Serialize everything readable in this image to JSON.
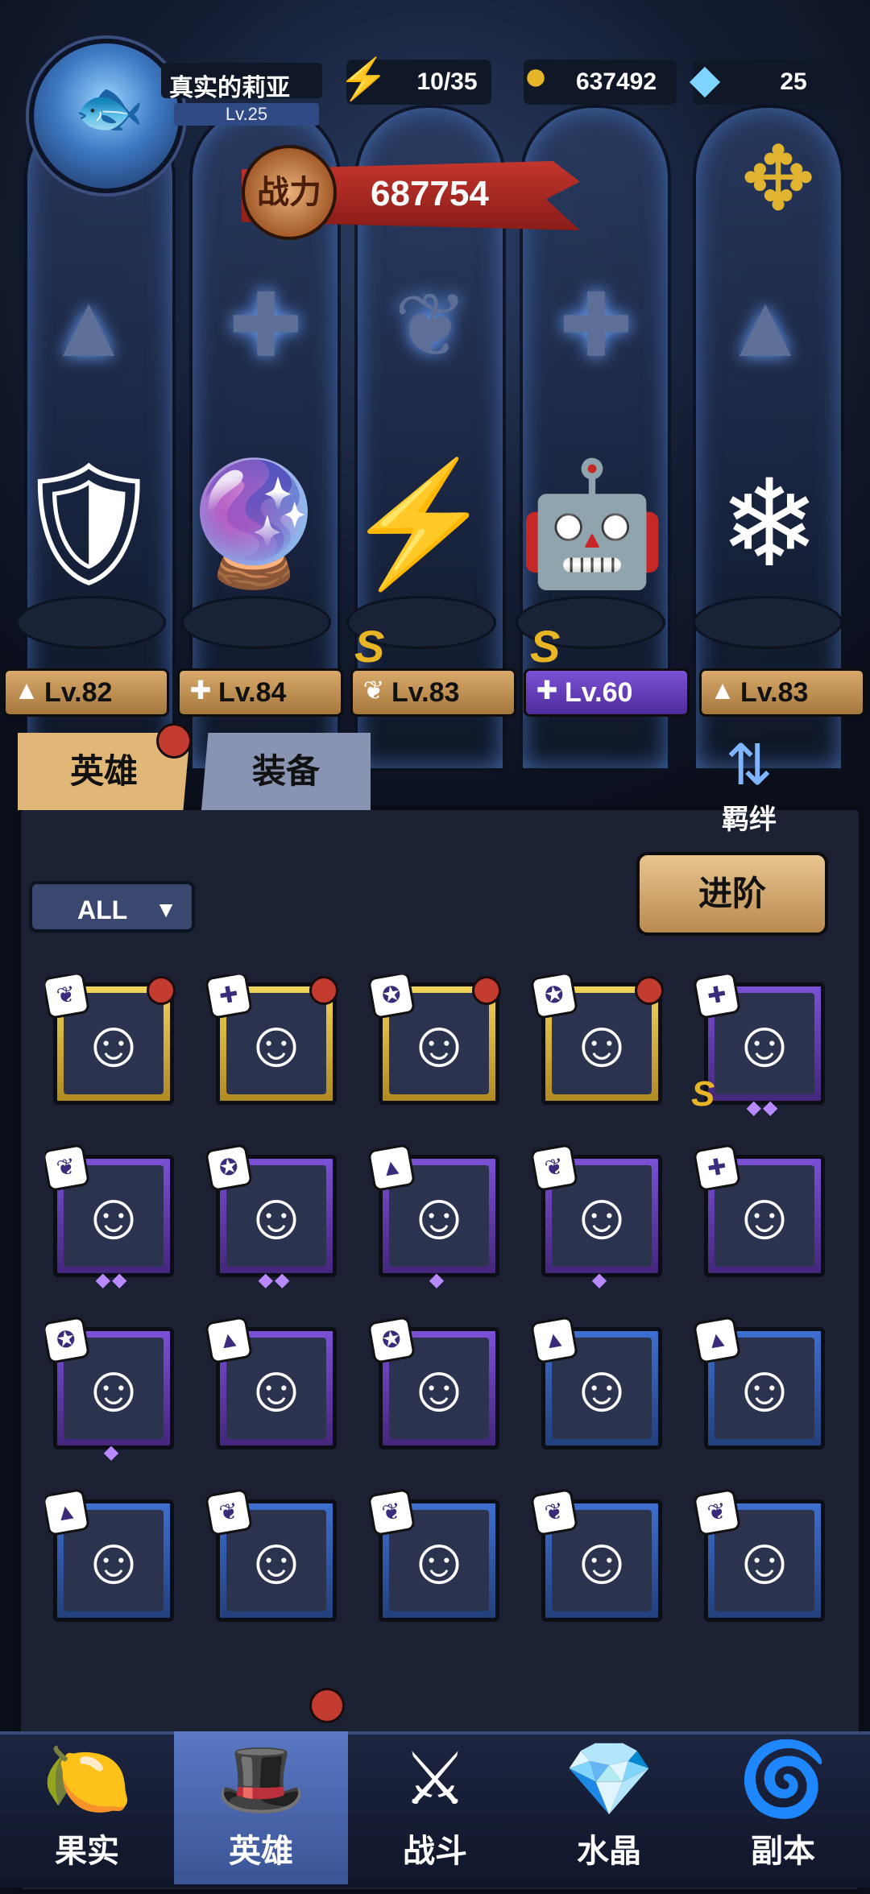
{
  "player": {
    "name": "真实的莉亚",
    "level": "Lv.25",
    "avatar_icon": "robot-fish-avatar"
  },
  "resources": {
    "energy": {
      "value": "10/35",
      "icon": "lightning-icon",
      "color": "#3fbf52"
    },
    "gold": {
      "value": "637492",
      "icon": "coin-icon",
      "color": "#e6b52a"
    },
    "diamond": {
      "value": "25",
      "icon": "diamond-icon",
      "color": "#7fd3ff"
    }
  },
  "power": {
    "label": "战力",
    "value": "687754"
  },
  "class_icons": [
    "mage-hat-icon",
    "wrench-icon",
    "wing-icon",
    "wrench-icon",
    "mage-hat-icon"
  ],
  "lineup": [
    {
      "level": "Lv.82",
      "class_icon": "mage-hat-icon",
      "plate": "gold",
      "grade": ""
    },
    {
      "level": "Lv.84",
      "class_icon": "wrench-icon",
      "plate": "gold",
      "grade": ""
    },
    {
      "level": "Lv.83",
      "class_icon": "wing-icon",
      "plate": "gold",
      "grade": "S"
    },
    {
      "level": "Lv.60",
      "class_icon": "wrench-icon",
      "plate": "purple",
      "grade": "S"
    },
    {
      "level": "Lv.83",
      "class_icon": "mage-hat-icon",
      "plate": "gold",
      "grade": ""
    }
  ],
  "tabs": {
    "heroes": "英雄",
    "equipment": "装备",
    "bond": "羁绊"
  },
  "filter": {
    "label": "ALL"
  },
  "advance_button": "进阶",
  "hero_grid": [
    {
      "frame": "gold",
      "badge": "wing",
      "dot": true,
      "stars": 0,
      "s": false
    },
    {
      "frame": "gold",
      "badge": "wrench",
      "dot": true,
      "stars": 0,
      "s": false
    },
    {
      "frame": "gold",
      "badge": "beast",
      "dot": true,
      "stars": 0,
      "s": false
    },
    {
      "frame": "gold",
      "badge": "beast",
      "dot": true,
      "stars": 0,
      "s": false
    },
    {
      "frame": "purple",
      "badge": "wrench",
      "dot": false,
      "stars": 2,
      "s": true
    },
    {
      "frame": "purple",
      "badge": "wing",
      "dot": false,
      "stars": 2,
      "s": false
    },
    {
      "frame": "purple",
      "badge": "beast",
      "dot": false,
      "stars": 2,
      "s": false
    },
    {
      "frame": "purple",
      "badge": "hat",
      "dot": false,
      "stars": 1,
      "s": false
    },
    {
      "frame": "purple",
      "badge": "wing",
      "dot": false,
      "stars": 1,
      "s": false
    },
    {
      "frame": "purple",
      "badge": "wrench",
      "dot": false,
      "stars": 0,
      "s": false
    },
    {
      "frame": "purple",
      "badge": "beast",
      "dot": false,
      "stars": 1,
      "s": false
    },
    {
      "frame": "purple",
      "badge": "hat",
      "dot": false,
      "stars": 0,
      "s": false
    },
    {
      "frame": "purple",
      "badge": "beast",
      "dot": false,
      "stars": 0,
      "s": false
    },
    {
      "frame": "blue",
      "badge": "hat",
      "dot": false,
      "stars": 0,
      "s": false
    },
    {
      "frame": "blue",
      "badge": "hat",
      "dot": false,
      "stars": 0,
      "s": false
    },
    {
      "frame": "blue",
      "badge": "hat",
      "dot": false,
      "stars": 0,
      "s": false
    },
    {
      "frame": "blue",
      "badge": "wing",
      "dot": false,
      "stars": 0,
      "s": false
    },
    {
      "frame": "blue",
      "badge": "wing",
      "dot": false,
      "stars": 0,
      "s": false
    },
    {
      "frame": "blue",
      "badge": "wing",
      "dot": false,
      "stars": 0,
      "s": false
    },
    {
      "frame": "blue",
      "badge": "wing",
      "dot": false,
      "stars": 0,
      "s": false
    }
  ],
  "nav": [
    {
      "label": "果实",
      "icon": "fruit-icon",
      "active": false
    },
    {
      "label": "英雄",
      "icon": "wizard-hat-icon",
      "active": true
    },
    {
      "label": "战斗",
      "icon": "sword-icon",
      "active": false
    },
    {
      "label": "水晶",
      "icon": "crystal-icon",
      "active": false
    },
    {
      "label": "副本",
      "icon": "portal-icon",
      "active": false
    }
  ]
}
